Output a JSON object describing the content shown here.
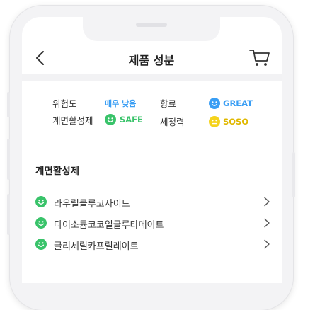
{
  "header": {
    "title": "제품 성분"
  },
  "summary": {
    "risk_label": "위험도",
    "risk_value": "매우 낮음",
    "fragrance_label": "향료",
    "fragrance_grade": "GREAT",
    "surfactant_label": "계면활성제",
    "surfactant_grade": "SAFE",
    "cleansing_label": "세정력",
    "cleansing_grade": "SOSO"
  },
  "section": {
    "title": "계면활성제",
    "items": [
      {
        "name": "라우릴클루코사이드"
      },
      {
        "name": "다이소듐코코일글루타메이트"
      },
      {
        "name": "글리세릴카프릴레이트"
      }
    ]
  },
  "colors": {
    "blue": "#3a9ef4",
    "green": "#39c36a",
    "yellow": "#f5d31c",
    "frame": "#f3f3f5"
  },
  "icons": {
    "back": "chevron-left-icon",
    "cart": "cart-icon",
    "blue_face": "smiley-blue-icon",
    "green_face": "smiley-green-icon",
    "yellow_face": "neutral-yellow-icon",
    "row_chevron": "chevron-right-icon"
  }
}
